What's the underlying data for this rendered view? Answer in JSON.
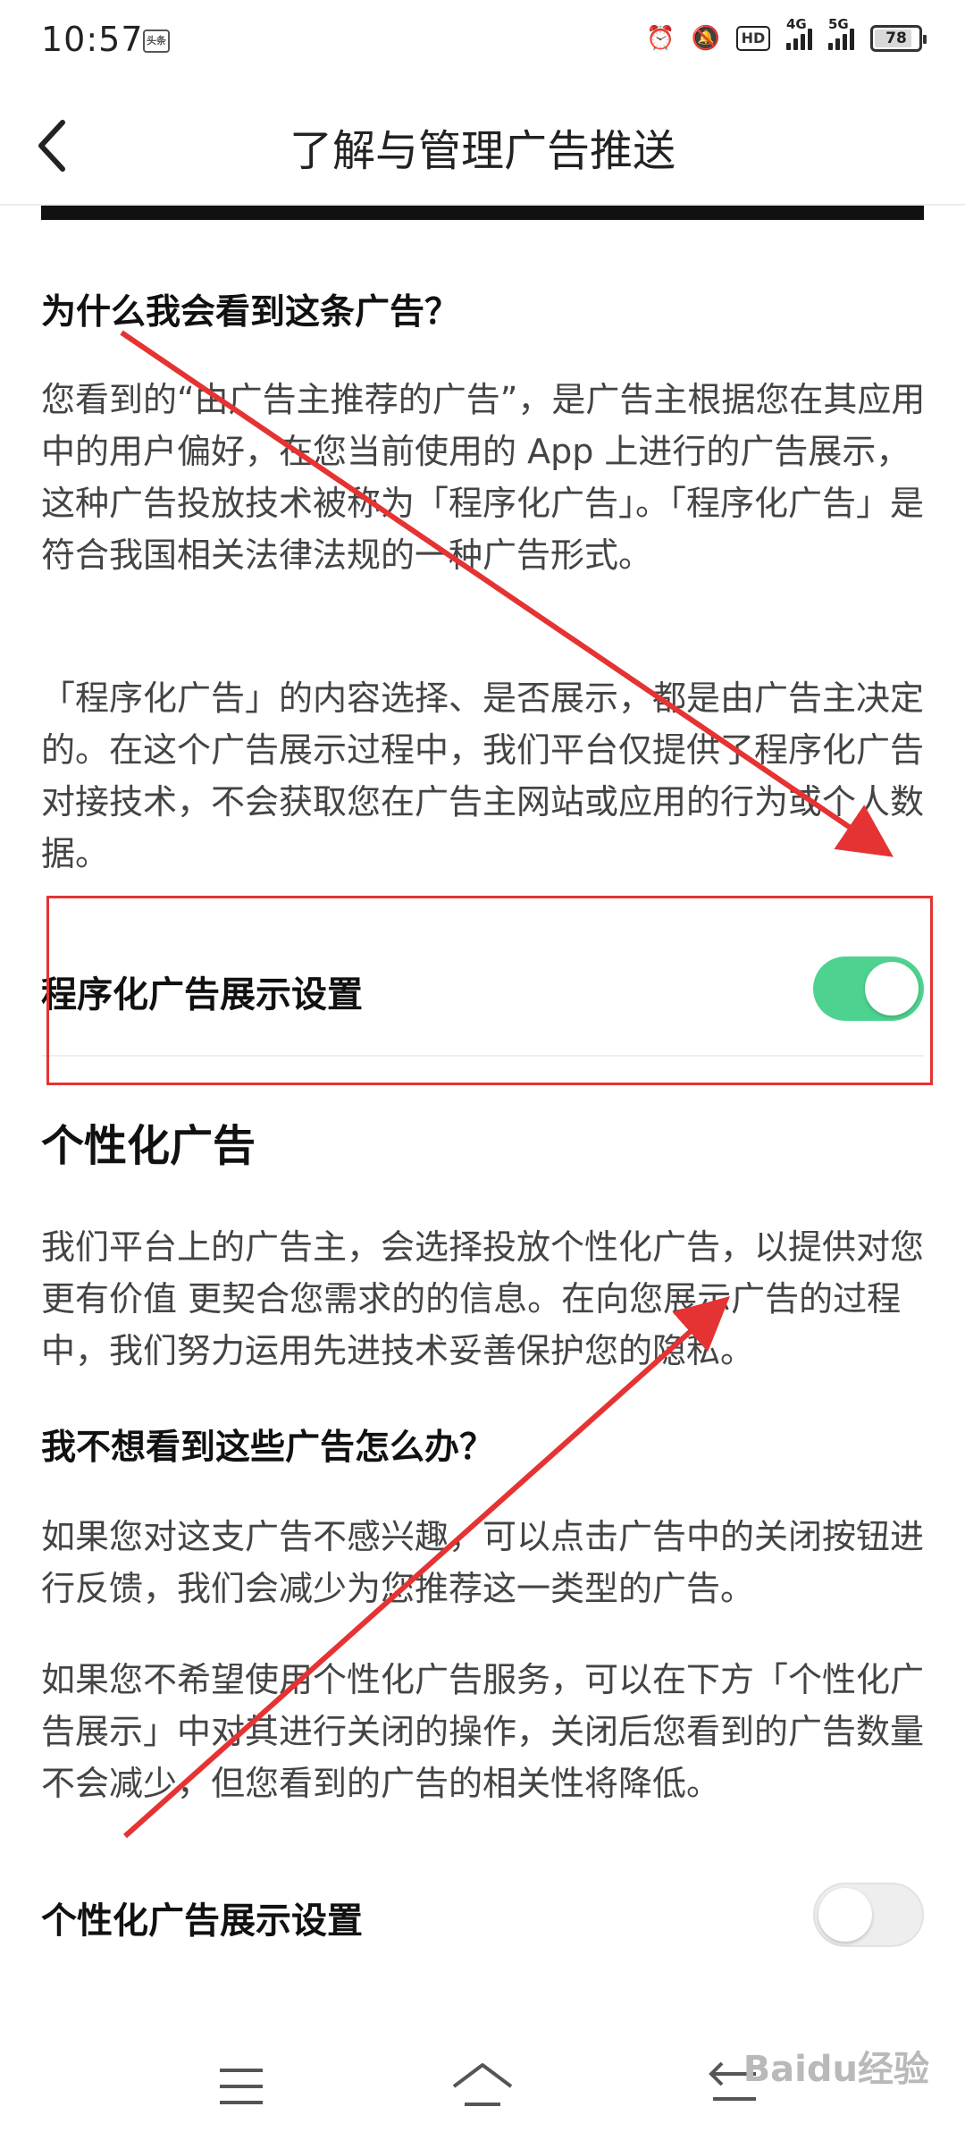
{
  "status_bar": {
    "time": "10:57",
    "app_badge": "头条",
    "hd": "HD",
    "signal1": "4G",
    "signal2": "5G",
    "battery": "78"
  },
  "nav": {
    "title": "了解与管理广告推送"
  },
  "section1": {
    "question": "为什么我会看到这条广告？",
    "para1": "您看到的“由广告主推荐的广告”，是广告主根据您在其应用中的用户偏好，在您当前使用的 App 上进行的广告展示，这种广告投放技术被称为「程序化广告」。「程序化广告」是符合我国相关法律法规的一种广告形式。",
    "para2": "「程序化广告」的内容选择、是否展示，都是由广告主决定的。在这个广告展示过程中，我们平台仅提供了程序化广告对接技术，不会获取您在广告主网站或应用的行为或个人数据。"
  },
  "setting1": {
    "label": "程序化广告展示设置",
    "enabled": true
  },
  "section2": {
    "title": "个性化广告",
    "para1": "我们平台上的广告主，会选择投放个性化广告，以提供对您更有价值 更契合您需求的的信息。在向您展示广告的过程中，我们努力运用先进技术妥善保护您的隐私。",
    "question": "我不想看到这些广告怎么办？",
    "para2": "如果您对这支广告不感兴趣，可以点击广告中的关闭按钮进行反馈，我们会减少为您推荐这一类型的广告。",
    "para3": "如果您不希望使用个性化广告服务，可以在下方「个性化广告展示」中对其进行关闭的操作，关闭后您看到的广告数量不会减少，但您看到的广告的相关性将降低。"
  },
  "setting2": {
    "label": "个性化广告展示设置",
    "enabled": false
  },
  "watermark": "Baidu经验",
  "colors": {
    "toggle_on": "#4dd38f",
    "annotation_red": "#e53333"
  },
  "icons": {
    "back": "chevron-left-icon",
    "menu": "menu-icon",
    "home": "home-icon",
    "return": "return-icon"
  }
}
